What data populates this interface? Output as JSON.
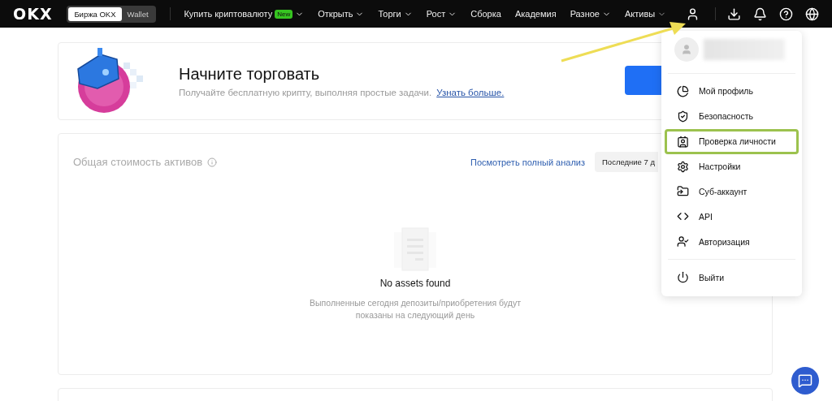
{
  "nav": {
    "logo": "OKX",
    "switch": [
      {
        "label": "Биржа OKX",
        "selected": true
      },
      {
        "label": "Wallet",
        "selected": false
      }
    ],
    "items": [
      {
        "label": "Купить криптовалюту",
        "badge": "New",
        "dropdown": true
      },
      {
        "label": "Открыть",
        "dropdown": true
      },
      {
        "label": "Торги",
        "dropdown": true
      },
      {
        "label": "Рост",
        "dropdown": true
      },
      {
        "label": "Сборка",
        "dropdown": false
      },
      {
        "label": "Академия",
        "dropdown": false
      },
      {
        "label": "Разное",
        "dropdown": true
      }
    ],
    "assets": {
      "label": "Активы",
      "dropdown": true
    }
  },
  "banner": {
    "title": "Начните торговать",
    "text": "Получайте бесплатную крипту, выполняя простые задачи.",
    "link": "Узнать больше."
  },
  "assets_card": {
    "title": "Общая стоимость активов",
    "analysis_link": "Посмотреть полный анализ",
    "period": "Последние 7 д",
    "empty_title": "No assets found",
    "empty_text": "Выполненные сегодня депозиты/приобретения будут показаны на следующий день"
  },
  "user_menu": {
    "items": [
      {
        "kind": "profile",
        "label": "Мой профиль",
        "highlighted": false
      },
      {
        "kind": "security",
        "label": "Безопасность",
        "highlighted": false
      },
      {
        "kind": "identity",
        "label": "Проверка личности",
        "highlighted": true
      },
      {
        "kind": "settings",
        "label": "Настройки",
        "highlighted": false
      },
      {
        "kind": "subaccount",
        "label": "Суб-аккаунт",
        "highlighted": false
      },
      {
        "kind": "api",
        "label": "API",
        "highlighted": false
      },
      {
        "kind": "login",
        "label": "Авторизация",
        "highlighted": false
      }
    ],
    "logout": "Выйти"
  }
}
